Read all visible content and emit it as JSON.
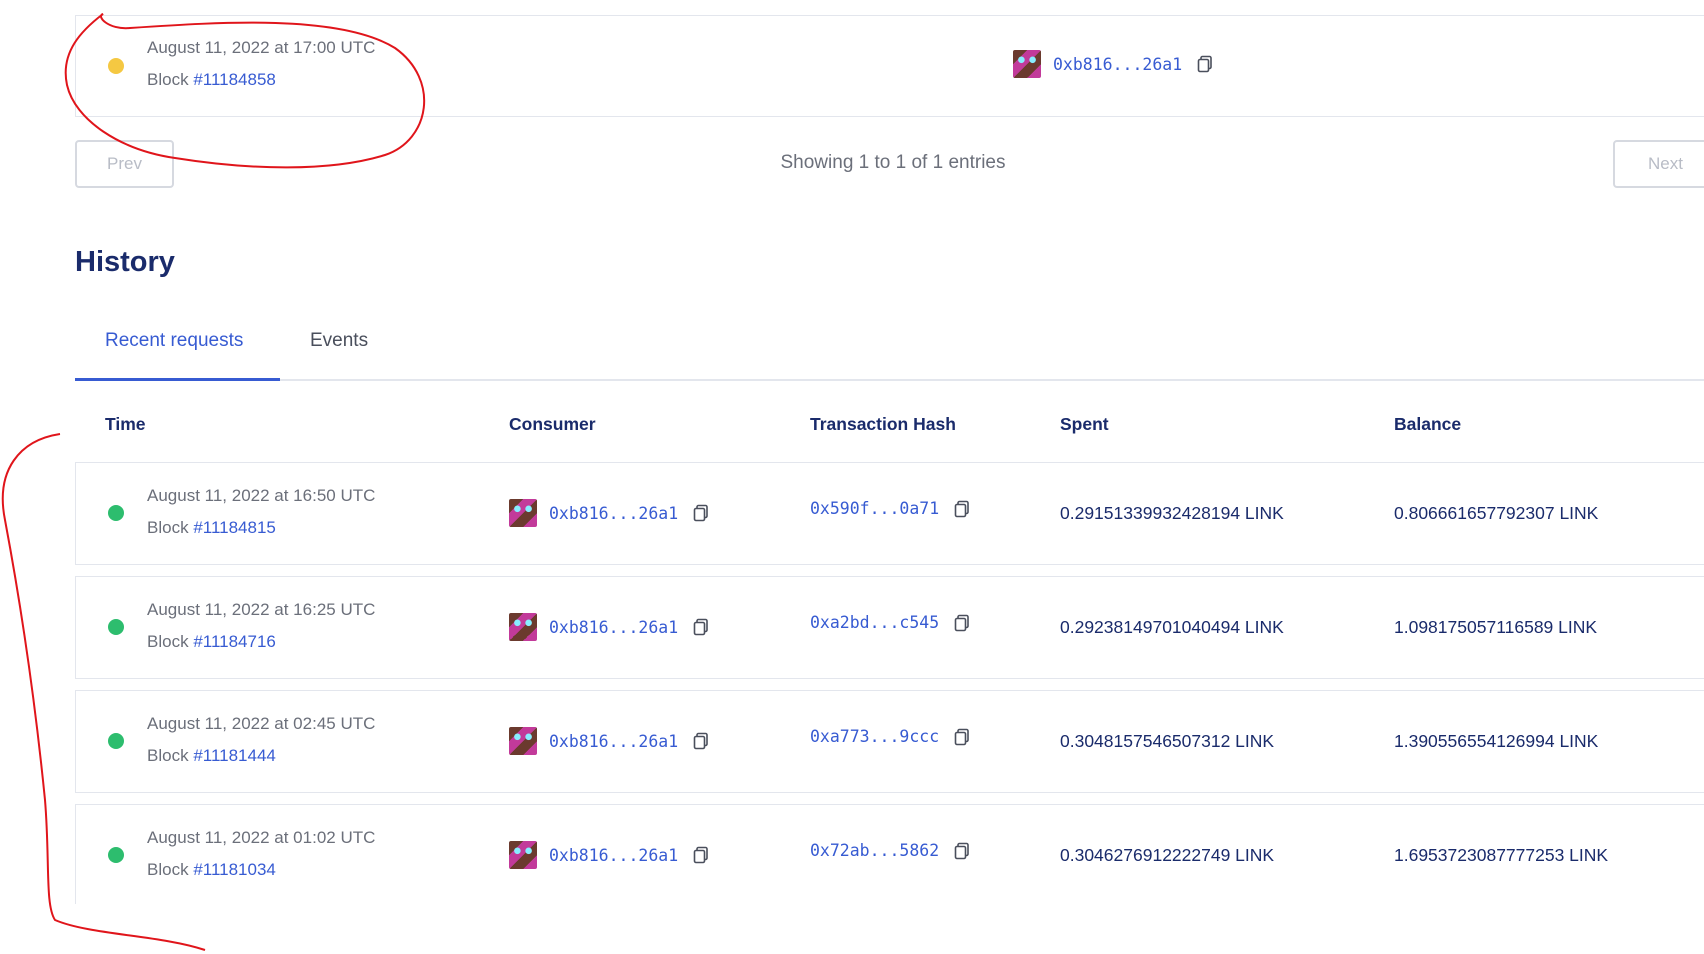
{
  "pending": {
    "date": "August 11, 2022 at 17:00 UTC",
    "block_label": "Block",
    "block_number": "#11184858",
    "consumer": "0xb816...26a1"
  },
  "pagination": {
    "prev_label": "Prev",
    "next_label": "Next",
    "showing": "Showing 1 to 1 of 1 entries"
  },
  "history": {
    "title": "History",
    "tabs": [
      {
        "label": "Recent requests"
      },
      {
        "label": "Events"
      }
    ],
    "columns": [
      "Time",
      "Consumer",
      "Transaction Hash",
      "Spent",
      "Balance"
    ],
    "rows": [
      {
        "date": "August 11, 2022 at 16:50 UTC",
        "block": "#11184815",
        "consumer": "0xb816...26a1",
        "tx": "0x590f...0a71",
        "spent": "0.29151339932428194 LINK",
        "balance": "0.806661657792307 LINK"
      },
      {
        "date": "August 11, 2022 at 16:25 UTC",
        "block": "#11184716",
        "consumer": "0xb816...26a1",
        "tx": "0xa2bd...c545",
        "spent": "0.29238149701040494 LINK",
        "balance": "1.098175057116589 LINK"
      },
      {
        "date": "August 11, 2022 at 02:45 UTC",
        "block": "#11181444",
        "consumer": "0xb816...26a1",
        "tx": "0xa773...9ccc",
        "spent": "0.3048157546507312 LINK",
        "balance": "1.390556554126994 LINK"
      },
      {
        "date": "August 11, 2022 at 01:02 UTC",
        "block": "#11181034",
        "consumer": "0xb816...26a1",
        "tx": "0x72ab...5862",
        "spent": "0.3046276912222749 LINK",
        "balance": "1.6953723087777253 LINK"
      }
    ],
    "block_label": "Block"
  },
  "colors": {
    "accent": "#375bd2",
    "heading": "#1a2b6b",
    "status_fulfilled": "#2dbd6e",
    "status_pending": "#f5c842",
    "annotation": "#e0151b"
  },
  "icons": {
    "copy": "copy-icon",
    "avatar": "identicon-avatar"
  }
}
